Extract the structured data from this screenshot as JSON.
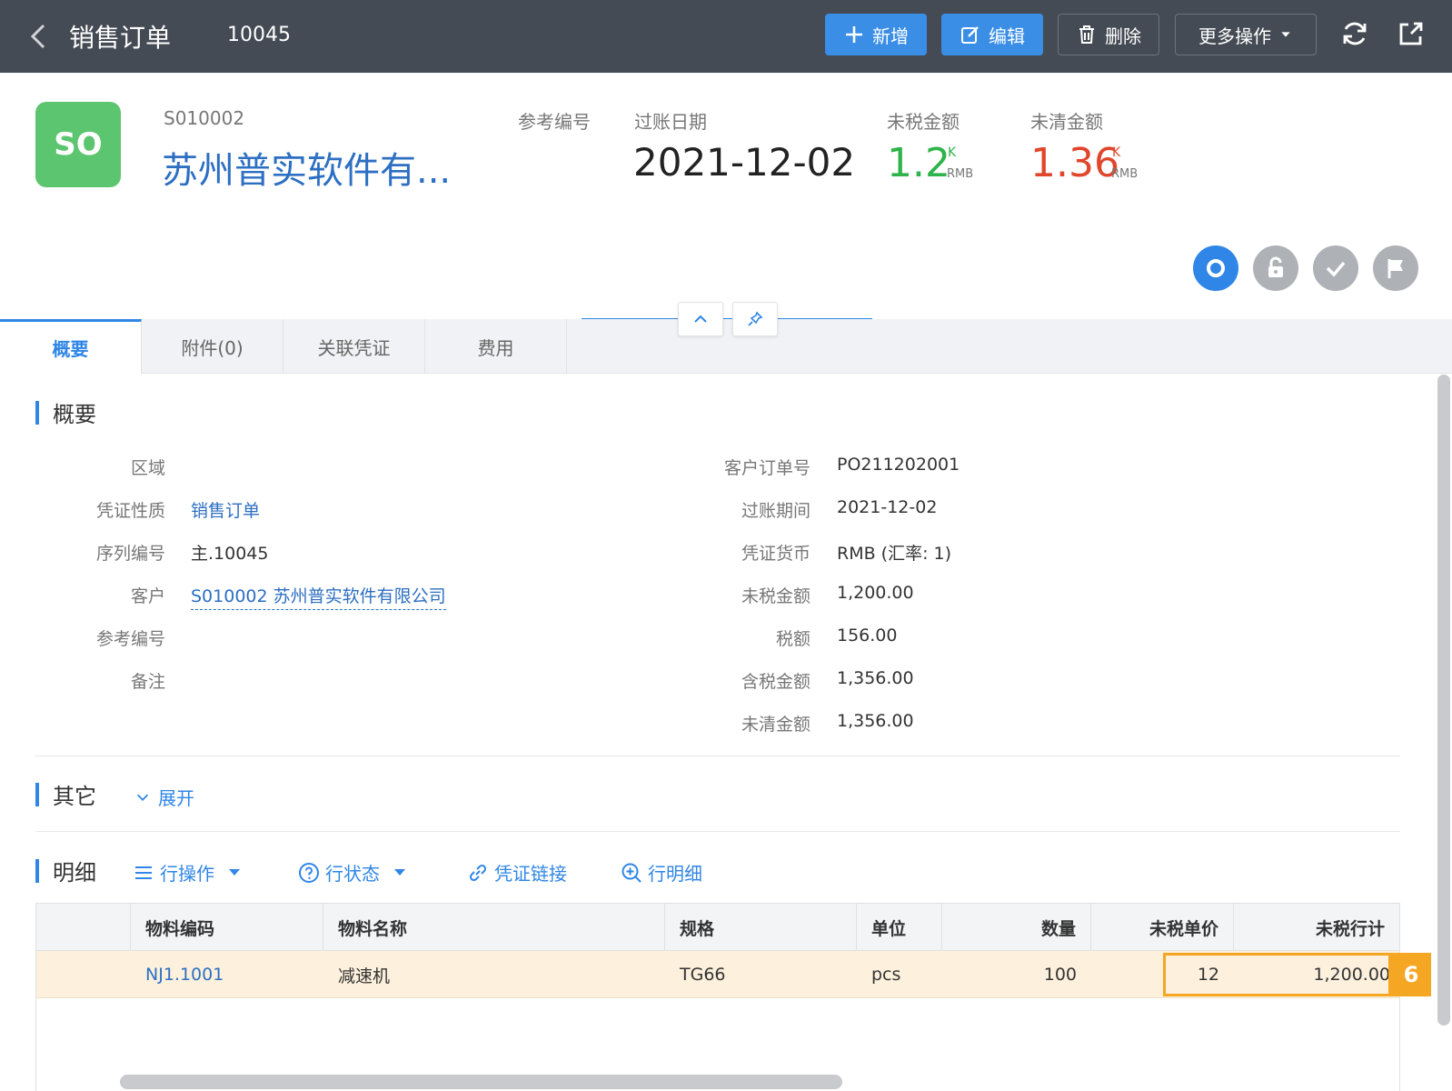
{
  "header": {
    "title": "销售订单",
    "doc_number": "10045",
    "buttons": {
      "add": "新增",
      "edit": "编辑",
      "delete": "删除",
      "more": "更多操作"
    }
  },
  "summary_head": {
    "badge": "SO",
    "customer_code": "S010002",
    "customer_name": "苏州普实软件有...",
    "ref_label": "参考编号",
    "posting_date_label": "过账日期",
    "posting_date": "2021-12-02",
    "pretax_label": "未税金额",
    "pretax_value": "1.2",
    "open_label": "未清金额",
    "open_value": "1.36",
    "unit_k": "K",
    "unit_currency": "RMB",
    "colors": {
      "green": "#2fb34a",
      "red": "#e0462b"
    }
  },
  "tabs": [
    "概要",
    "附件(0)",
    "关联凭证",
    "费用"
  ],
  "overview": {
    "title": "概要",
    "left_fields": [
      {
        "label": "区域",
        "value": ""
      },
      {
        "label": "凭证性质",
        "value": "销售订单"
      },
      {
        "label": "序列编号",
        "value": "主.10045"
      },
      {
        "label": "客户",
        "value": "S010002 苏州普实软件有限公司"
      },
      {
        "label": "参考编号",
        "value": ""
      },
      {
        "label": "备注",
        "value": ""
      }
    ],
    "right_fields": [
      {
        "label": "客户订单号",
        "value": "PO211202001"
      },
      {
        "label": "过账期间",
        "value": "2021-12-02"
      },
      {
        "label": "凭证货币",
        "value": "RMB (汇率: 1)"
      },
      {
        "label": "未税金额",
        "value": "1,200.00"
      },
      {
        "label": "税额",
        "value": "156.00"
      },
      {
        "label": "含税金额",
        "value": "1,356.00"
      },
      {
        "label": "未清金额",
        "value": "1,356.00"
      }
    ]
  },
  "other": {
    "title": "其它",
    "expand": "展开"
  },
  "detail": {
    "title": "明细",
    "toolbar": {
      "row_ops": "行操作",
      "row_status": "行状态",
      "voucher_link": "凭证链接",
      "row_detail": "行明细"
    },
    "columns": [
      "物料编码",
      "物料名称",
      "规格",
      "单位",
      "数量",
      "未税单价",
      "未税行计"
    ],
    "rows": [
      {
        "code": "NJ1.1001",
        "name": "减速机",
        "spec": "TG66",
        "unit": "pcs",
        "qty": "100",
        "price": "12",
        "total": "1,200.00"
      }
    ],
    "highlight_badge": "6"
  }
}
